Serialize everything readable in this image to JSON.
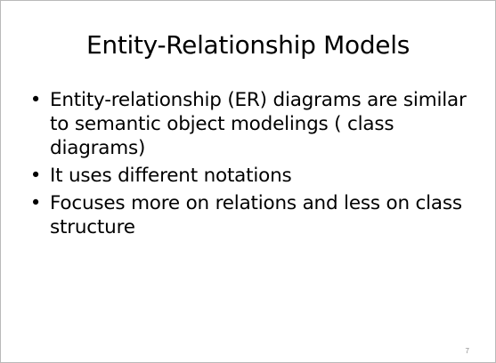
{
  "slide": {
    "title": "Entity-Relationship Models",
    "bullets": [
      {
        "marker": "•",
        "text": "Entity-relationship (ER) diagrams are similar to semantic object modelings ( class diagrams)"
      },
      {
        "marker": "•",
        "text": "It uses different notations"
      },
      {
        "marker": "•",
        "text": "Focuses more on relations and less on class structure"
      }
    ],
    "page_number": "7"
  }
}
